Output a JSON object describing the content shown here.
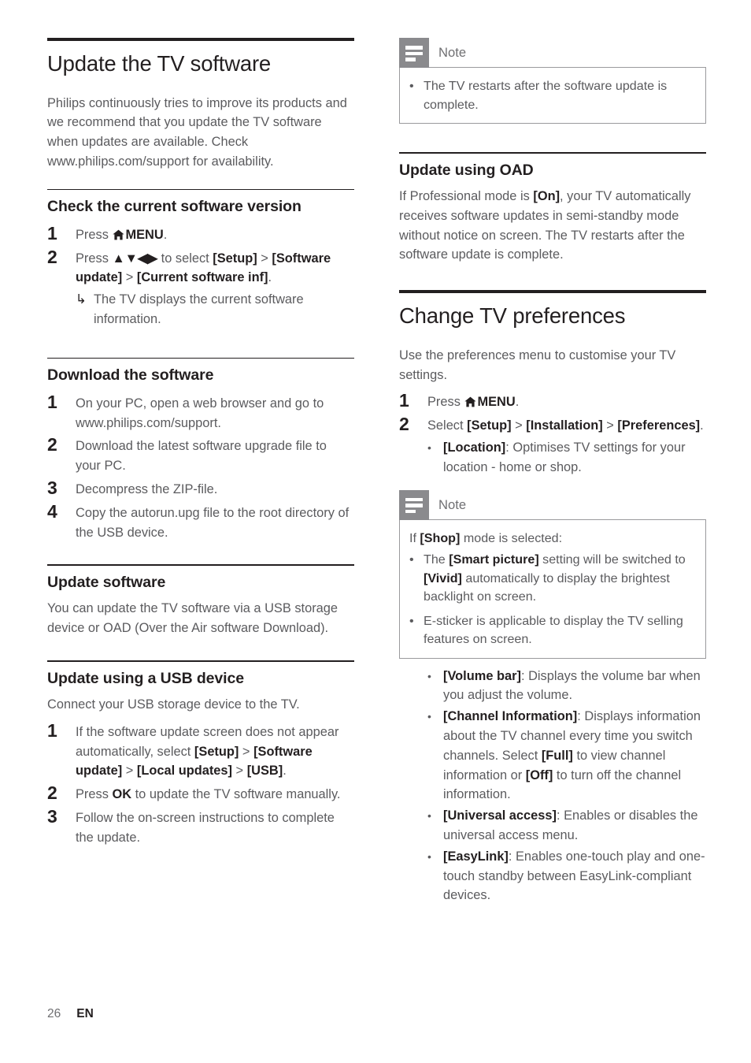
{
  "document": {
    "footer": {
      "page_number": "26",
      "language": "EN"
    },
    "note_label": "Note",
    "icons": {
      "home": "home-icon",
      "note": "note-icon",
      "arrow_up": "▲",
      "arrow_down": "▼",
      "arrow_left": "◀",
      "arrow_right": "▶",
      "result_arrow": "↳",
      "bullet": "•"
    },
    "colors": {
      "heading": "#231f20",
      "body_text": "#5b5b5e",
      "note_icon_bg": "#8a8a8d",
      "note_border": "#9a9a9d",
      "rule": "#231f20"
    }
  },
  "left_column": {
    "h1": "Update the TV software",
    "intro": "Philips continuously tries to improve its products and we recommend that you update the TV software when updates are available. Check www.philips.com/support for availability.",
    "check_version": {
      "heading": "Check the current software version",
      "step1_num": "1",
      "step1_pre": "Press ",
      "step1_menu": "MENU",
      "step1_post": ".",
      "step2_num": "2",
      "step2_pre": "Press ",
      "step2_arrows": "▲▼◀▶",
      "step2_mid": " to select ",
      "step2_b1": "[Setup]",
      "step2_gt1": " > ",
      "step2_b2": "[Software update]",
      "step2_gt2": " > ",
      "step2_b3": "[Current software inf]",
      "step2_end": ".",
      "result_arrow": "↳",
      "result_text": "The TV displays the current software information."
    },
    "download": {
      "heading": "Download the software",
      "steps": [
        {
          "num": "1",
          "text": "On your PC, open a web browser and go to www.philips.com/support."
        },
        {
          "num": "2",
          "text": "Download the latest software upgrade file to your PC."
        },
        {
          "num": "3",
          "text": "Decompress the ZIP-file."
        },
        {
          "num": "4",
          "text": "Copy the autorun.upg file to the root directory of the USB device."
        }
      ]
    },
    "update_software": {
      "heading": "Update software",
      "text": "You can update the TV software via a USB storage device or OAD (Over the Air software Download)."
    },
    "update_usb": {
      "heading": "Update using a USB device",
      "intro": "Connect your USB storage device to the TV.",
      "step1_num": "1",
      "step1_a": "If the software update screen does not appear automatically, select ",
      "step1_b1": "[Setup]",
      "step1_gt1": " > ",
      "step1_b2": "[Software update]",
      "step1_gt2": " > ",
      "step1_b3": "[Local updates]",
      "step1_gt3": " > ",
      "step1_b4": "[USB]",
      "step1_end": ".",
      "step2_num": "2",
      "step2_a": "Press ",
      "step2_ok": "OK",
      "step2_b": " to update the TV software manually.",
      "step3_num": "3",
      "step3_text": "Follow the on-screen instructions to complete the update."
    }
  },
  "right_column": {
    "note_top": {
      "title": "Note",
      "bullets": [
        "The TV restarts after the software update is complete."
      ]
    },
    "update_oad": {
      "heading": "Update using OAD",
      "pre": "If Professional mode is ",
      "bold": "[On]",
      "post": ", your TV automatically receives software updates in semi-standby mode without notice on screen. The TV restarts after the software update is complete."
    },
    "change_prefs": {
      "h1": "Change TV preferences",
      "intro": "Use the preferences menu to customise your TV settings.",
      "step1_num": "1",
      "step1_pre": "Press ",
      "step1_menu": "MENU",
      "step1_post": ".",
      "step2_num": "2",
      "step2_pre": "Select ",
      "step2_b1": "[Setup]",
      "step2_gt1": " > ",
      "step2_b2": "[Installation]",
      "step2_gt2": " > ",
      "step2_b3": "[Preferences]",
      "step2_end": ".",
      "location_bold": "[Location]",
      "location_text": ": Optimises TV settings for your location - home or shop."
    },
    "note_shop": {
      "title": "Note",
      "lead_pre": "If ",
      "lead_bold": "[Shop]",
      "lead_post": " mode is selected:",
      "b1_a": "The ",
      "b1_b1": "[Smart picture]",
      "b1_b": " setting will be switched to ",
      "b1_b2": "[Vivid]",
      "b1_c": " automatically to display the brightest backlight on screen.",
      "b2_text": "E-sticker is applicable to display the TV selling features on screen."
    },
    "prefs_bullets": {
      "volume_bold": "[Volume bar]",
      "volume_text": ": Displays the volume bar when you adjust the volume.",
      "channel_bold": "[Channel Information]",
      "channel_a": ": Displays information about the TV channel every time you switch channels. Select ",
      "channel_b1": "[Full]",
      "channel_b": " to view channel information or ",
      "channel_b2": "[Off]",
      "channel_c": " to turn off the channel information.",
      "universal_bold": "[Universal access]",
      "universal_text": ": Enables or disables the universal access menu.",
      "easylink_bold": "[EasyLink]",
      "easylink_text": ": Enables one-touch play and one-touch standby between EasyLink-compliant devices."
    }
  }
}
